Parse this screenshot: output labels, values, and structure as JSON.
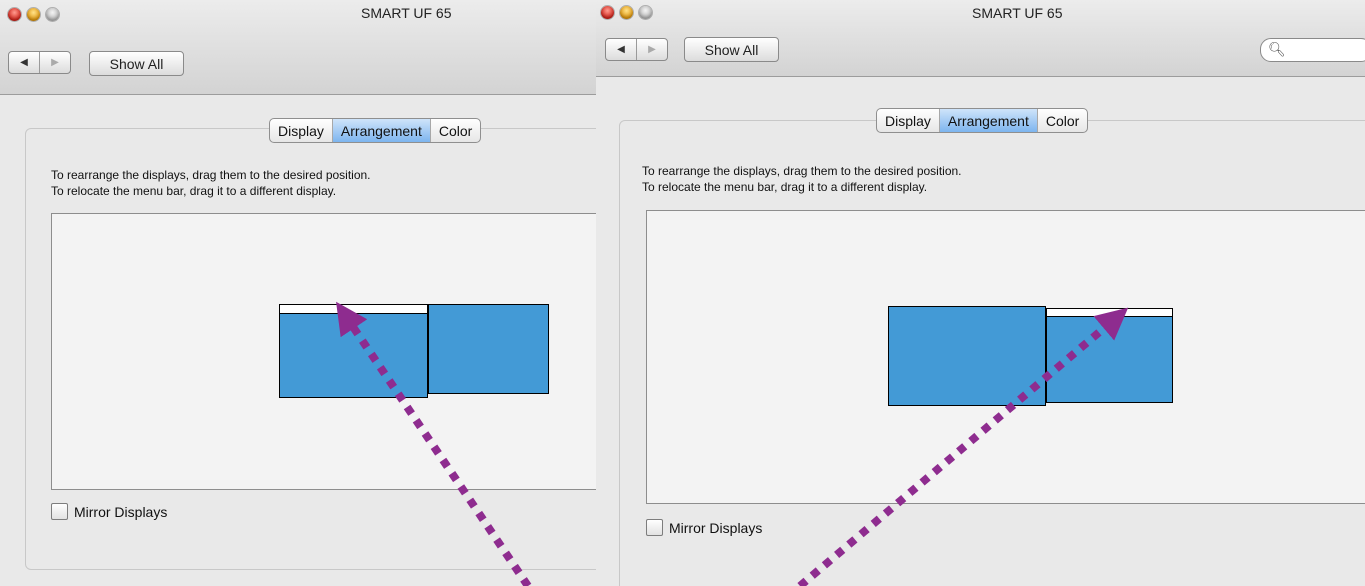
{
  "windows": [
    {
      "id": "left",
      "title": "SMART UF 65",
      "nav": {
        "back": "◀",
        "forward": "▶"
      },
      "show_all_label": "Show All",
      "tabs": [
        "Display",
        "Arrangement",
        "Color"
      ],
      "active_tab": "Arrangement",
      "instructions": [
        "To rearrange the displays, drag them to the desired position.",
        "To relocate the menu bar, drag it to a different display."
      ],
      "mirror_label": "Mirror Displays",
      "mirror_checked": false,
      "menu_bar_on": "left display"
    },
    {
      "id": "right",
      "title": "SMART UF 65",
      "nav": {
        "back": "◀",
        "forward": "▶"
      },
      "show_all_label": "Show All",
      "search_icon": "search-icon",
      "tabs": [
        "Display",
        "Arrangement",
        "Color"
      ],
      "active_tab": "Arrangement",
      "instructions": [
        "To rearrange the displays, drag them to the desired position.",
        "To relocate the menu bar, drag it to a different display."
      ],
      "mirror_label": "Mirror Displays",
      "mirror_checked": false,
      "menu_bar_on": "right display"
    }
  ],
  "colors": {
    "display_fill": "#439ad6",
    "arrow": "#8e2c8f",
    "active_tab": "#7db5ef"
  }
}
